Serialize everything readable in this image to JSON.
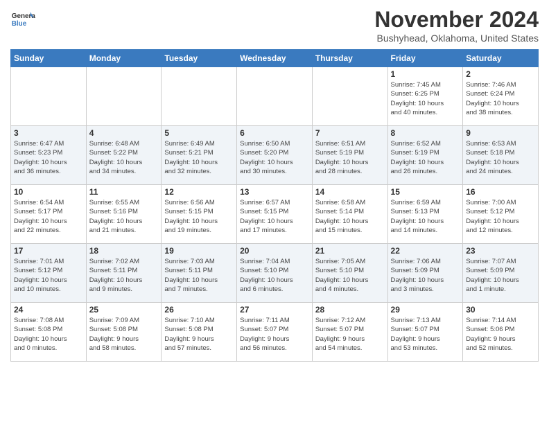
{
  "header": {
    "logo_line1": "General",
    "logo_line2": "Blue",
    "month": "November 2024",
    "location": "Bushyhead, Oklahoma, United States"
  },
  "weekdays": [
    "Sunday",
    "Monday",
    "Tuesday",
    "Wednesday",
    "Thursday",
    "Friday",
    "Saturday"
  ],
  "weeks": [
    [
      {
        "day": "",
        "info": ""
      },
      {
        "day": "",
        "info": ""
      },
      {
        "day": "",
        "info": ""
      },
      {
        "day": "",
        "info": ""
      },
      {
        "day": "",
        "info": ""
      },
      {
        "day": "1",
        "info": "Sunrise: 7:45 AM\nSunset: 6:25 PM\nDaylight: 10 hours\nand 40 minutes."
      },
      {
        "day": "2",
        "info": "Sunrise: 7:46 AM\nSunset: 6:24 PM\nDaylight: 10 hours\nand 38 minutes."
      }
    ],
    [
      {
        "day": "3",
        "info": "Sunrise: 6:47 AM\nSunset: 5:23 PM\nDaylight: 10 hours\nand 36 minutes."
      },
      {
        "day": "4",
        "info": "Sunrise: 6:48 AM\nSunset: 5:22 PM\nDaylight: 10 hours\nand 34 minutes."
      },
      {
        "day": "5",
        "info": "Sunrise: 6:49 AM\nSunset: 5:21 PM\nDaylight: 10 hours\nand 32 minutes."
      },
      {
        "day": "6",
        "info": "Sunrise: 6:50 AM\nSunset: 5:20 PM\nDaylight: 10 hours\nand 30 minutes."
      },
      {
        "day": "7",
        "info": "Sunrise: 6:51 AM\nSunset: 5:19 PM\nDaylight: 10 hours\nand 28 minutes."
      },
      {
        "day": "8",
        "info": "Sunrise: 6:52 AM\nSunset: 5:19 PM\nDaylight: 10 hours\nand 26 minutes."
      },
      {
        "day": "9",
        "info": "Sunrise: 6:53 AM\nSunset: 5:18 PM\nDaylight: 10 hours\nand 24 minutes."
      }
    ],
    [
      {
        "day": "10",
        "info": "Sunrise: 6:54 AM\nSunset: 5:17 PM\nDaylight: 10 hours\nand 22 minutes."
      },
      {
        "day": "11",
        "info": "Sunrise: 6:55 AM\nSunset: 5:16 PM\nDaylight: 10 hours\nand 21 minutes."
      },
      {
        "day": "12",
        "info": "Sunrise: 6:56 AM\nSunset: 5:15 PM\nDaylight: 10 hours\nand 19 minutes."
      },
      {
        "day": "13",
        "info": "Sunrise: 6:57 AM\nSunset: 5:15 PM\nDaylight: 10 hours\nand 17 minutes."
      },
      {
        "day": "14",
        "info": "Sunrise: 6:58 AM\nSunset: 5:14 PM\nDaylight: 10 hours\nand 15 minutes."
      },
      {
        "day": "15",
        "info": "Sunrise: 6:59 AM\nSunset: 5:13 PM\nDaylight: 10 hours\nand 14 minutes."
      },
      {
        "day": "16",
        "info": "Sunrise: 7:00 AM\nSunset: 5:12 PM\nDaylight: 10 hours\nand 12 minutes."
      }
    ],
    [
      {
        "day": "17",
        "info": "Sunrise: 7:01 AM\nSunset: 5:12 PM\nDaylight: 10 hours\nand 10 minutes."
      },
      {
        "day": "18",
        "info": "Sunrise: 7:02 AM\nSunset: 5:11 PM\nDaylight: 10 hours\nand 9 minutes."
      },
      {
        "day": "19",
        "info": "Sunrise: 7:03 AM\nSunset: 5:11 PM\nDaylight: 10 hours\nand 7 minutes."
      },
      {
        "day": "20",
        "info": "Sunrise: 7:04 AM\nSunset: 5:10 PM\nDaylight: 10 hours\nand 6 minutes."
      },
      {
        "day": "21",
        "info": "Sunrise: 7:05 AM\nSunset: 5:10 PM\nDaylight: 10 hours\nand 4 minutes."
      },
      {
        "day": "22",
        "info": "Sunrise: 7:06 AM\nSunset: 5:09 PM\nDaylight: 10 hours\nand 3 minutes."
      },
      {
        "day": "23",
        "info": "Sunrise: 7:07 AM\nSunset: 5:09 PM\nDaylight: 10 hours\nand 1 minute."
      }
    ],
    [
      {
        "day": "24",
        "info": "Sunrise: 7:08 AM\nSunset: 5:08 PM\nDaylight: 10 hours\nand 0 minutes."
      },
      {
        "day": "25",
        "info": "Sunrise: 7:09 AM\nSunset: 5:08 PM\nDaylight: 9 hours\nand 58 minutes."
      },
      {
        "day": "26",
        "info": "Sunrise: 7:10 AM\nSunset: 5:08 PM\nDaylight: 9 hours\nand 57 minutes."
      },
      {
        "day": "27",
        "info": "Sunrise: 7:11 AM\nSunset: 5:07 PM\nDaylight: 9 hours\nand 56 minutes."
      },
      {
        "day": "28",
        "info": "Sunrise: 7:12 AM\nSunset: 5:07 PM\nDaylight: 9 hours\nand 54 minutes."
      },
      {
        "day": "29",
        "info": "Sunrise: 7:13 AM\nSunset: 5:07 PM\nDaylight: 9 hours\nand 53 minutes."
      },
      {
        "day": "30",
        "info": "Sunrise: 7:14 AM\nSunset: 5:06 PM\nDaylight: 9 hours\nand 52 minutes."
      }
    ]
  ]
}
